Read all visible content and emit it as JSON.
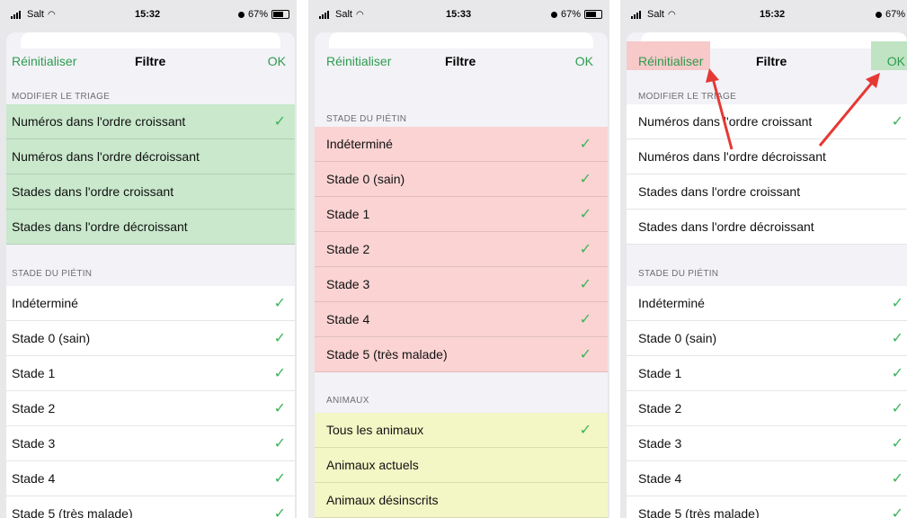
{
  "colors": {
    "accent": "#2e9b4e",
    "check": "#3cb55a",
    "highlight_green": "#c9e8cc",
    "highlight_red": "#fbd3d3",
    "highlight_yellow": "#f3f6c5",
    "arrow": "#e53935"
  },
  "screens": [
    {
      "status": {
        "carrier": "Salt",
        "time": "15:32",
        "battery": "67%"
      },
      "nav": {
        "reset": "Réinitialiser",
        "title": "Filtre",
        "ok": "OK"
      },
      "sort": {
        "header": "MODIFIER LE TRIAGE",
        "items": [
          {
            "label": "Numéros dans l'ordre croissant",
            "checked": true
          },
          {
            "label": "Numéros dans l'ordre décroissant",
            "checked": false
          },
          {
            "label": "Stades dans l'ordre croissant",
            "checked": false
          },
          {
            "label": "Stades dans l'ordre décroissant",
            "checked": false
          }
        ]
      },
      "stage": {
        "header": "STADE DU PIÉTIN",
        "items": [
          {
            "label": "Indéterminé",
            "checked": true
          },
          {
            "label": "Stade 0 (sain)",
            "checked": true
          },
          {
            "label": "Stade 1",
            "checked": true
          },
          {
            "label": "Stade 2",
            "checked": true
          },
          {
            "label": "Stade 3",
            "checked": true
          },
          {
            "label": "Stade 4",
            "checked": true
          },
          {
            "label": "Stade 5 (très malade)",
            "checked": true
          }
        ]
      }
    },
    {
      "status": {
        "carrier": "Salt",
        "time": "15:33",
        "battery": "67%"
      },
      "nav": {
        "reset": "Réinitialiser",
        "title": "Filtre",
        "ok": "OK"
      },
      "stage": {
        "header": "STADE DU PIÉTIN",
        "items": [
          {
            "label": "Indéterminé",
            "checked": true
          },
          {
            "label": "Stade 0 (sain)",
            "checked": true
          },
          {
            "label": "Stade 1",
            "checked": true
          },
          {
            "label": "Stade 2",
            "checked": true
          },
          {
            "label": "Stade 3",
            "checked": true
          },
          {
            "label": "Stade 4",
            "checked": true
          },
          {
            "label": "Stade 5 (très malade)",
            "checked": true
          }
        ]
      },
      "animals": {
        "header": "ANIMAUX",
        "items": [
          {
            "label": "Tous les animaux",
            "checked": true
          },
          {
            "label": "Animaux actuels",
            "checked": false
          },
          {
            "label": "Animaux désinscrits",
            "checked": false
          }
        ]
      }
    },
    {
      "status": {
        "carrier": "Salt",
        "time": "15:32",
        "battery": "67%"
      },
      "nav": {
        "reset": "Réinitialiser",
        "title": "Filtre",
        "ok": "OK"
      },
      "sort": {
        "header": "MODIFIER LE TRIAGE",
        "items": [
          {
            "label": "Numéros dans l'ordre croissant",
            "checked": true
          },
          {
            "label": "Numéros dans l'ordre décroissant",
            "checked": false
          },
          {
            "label": "Stades dans l'ordre croissant",
            "checked": false
          },
          {
            "label": "Stades dans l'ordre décroissant",
            "checked": false
          }
        ]
      },
      "stage": {
        "header": "STADE DU PIÉTIN",
        "items": [
          {
            "label": "Indéterminé",
            "checked": true
          },
          {
            "label": "Stade 0 (sain)",
            "checked": true
          },
          {
            "label": "Stade 1",
            "checked": true
          },
          {
            "label": "Stade 2",
            "checked": true
          },
          {
            "label": "Stade 3",
            "checked": true
          },
          {
            "label": "Stade 4",
            "checked": true
          },
          {
            "label": "Stade 5 (très malade)",
            "checked": true
          }
        ]
      }
    }
  ],
  "check_glyph": "✓"
}
